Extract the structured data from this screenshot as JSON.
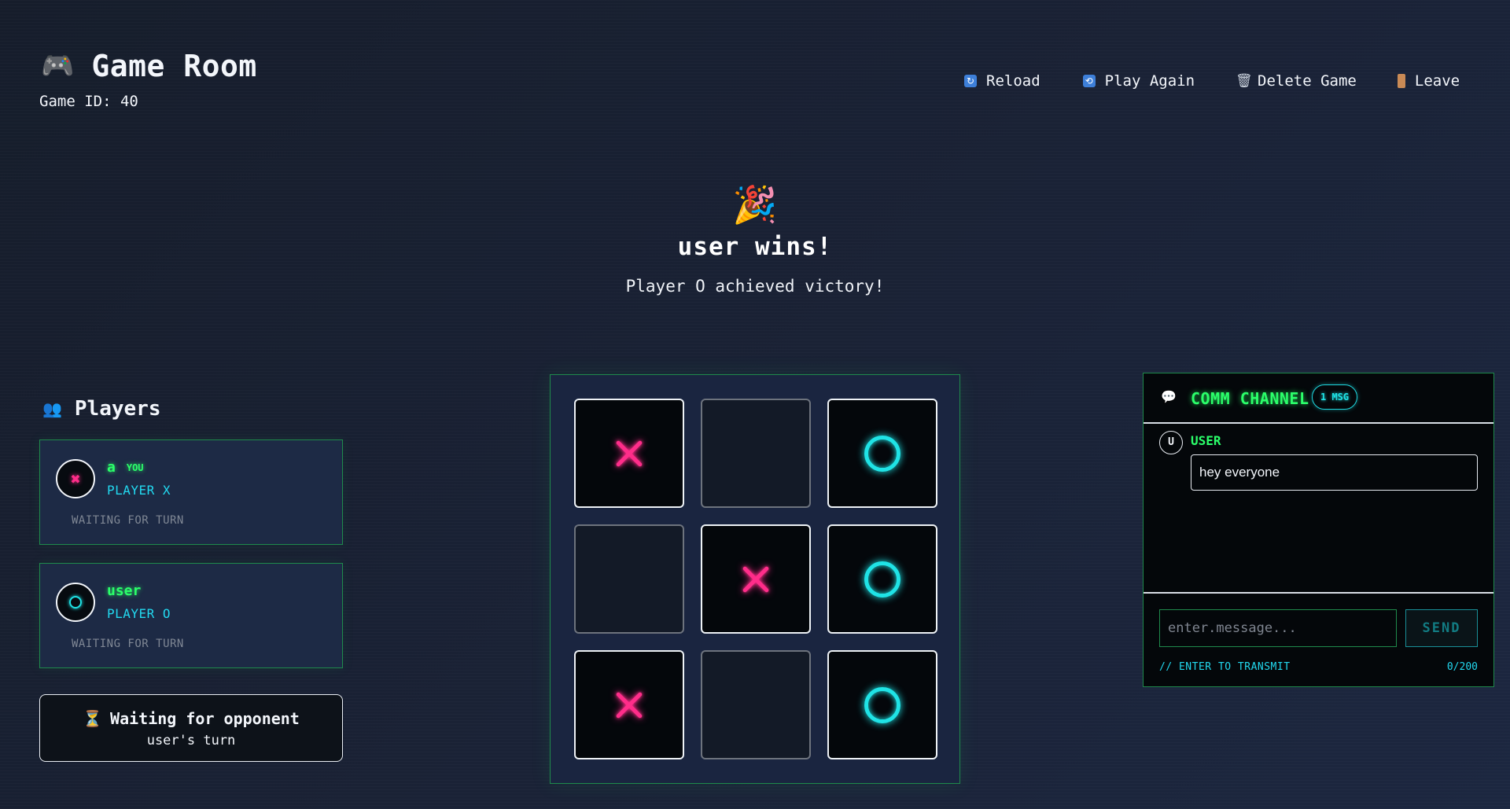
{
  "header": {
    "icon": "gamepad-icon",
    "title": "Game Room",
    "game_id": "Game ID: 40"
  },
  "actions": [
    {
      "label": "Reload",
      "icon": "reload-icon"
    },
    {
      "label": "Play Again",
      "icon": "repeat-icon"
    },
    {
      "label": "Delete Game",
      "icon": "trash-icon"
    },
    {
      "label": "Leave",
      "icon": "door-icon"
    }
  ],
  "banner": {
    "icon": "party-popper-icon",
    "title": "user wins!",
    "subtitle": "Player O achieved victory!"
  },
  "players": {
    "title": "Players",
    "icon": "users-icon",
    "list": [
      {
        "name": "a",
        "badge": "YOU",
        "role": "PLAYER X",
        "symbol": "X",
        "status": "WAITING FOR TURN"
      },
      {
        "name": "user",
        "badge": "",
        "role": "PLAYER O",
        "symbol": "O",
        "status": "WAITING FOR TURN"
      }
    ]
  },
  "turn_box": {
    "title": "Waiting for opponent",
    "subtitle": "user's turn"
  },
  "board": {
    "cells": [
      "X",
      "",
      "O",
      "",
      "X",
      "O",
      "X",
      "",
      "O"
    ]
  },
  "chat": {
    "title": "COMM CHANNEL",
    "count": "1 MSG",
    "messages": [
      {
        "avatar": "U",
        "user": "USER",
        "text": "hey everyone"
      }
    ],
    "input_placeholder": "enter.message...",
    "send_label": "SEND",
    "hint": "// ENTER TO TRANSMIT",
    "char_count": "0/200"
  },
  "colors": {
    "x_mark": "#ff2d8a",
    "o_mark": "#1fe3e6",
    "neon_green": "#2bff6a",
    "cyan_text": "#22d9f0"
  }
}
